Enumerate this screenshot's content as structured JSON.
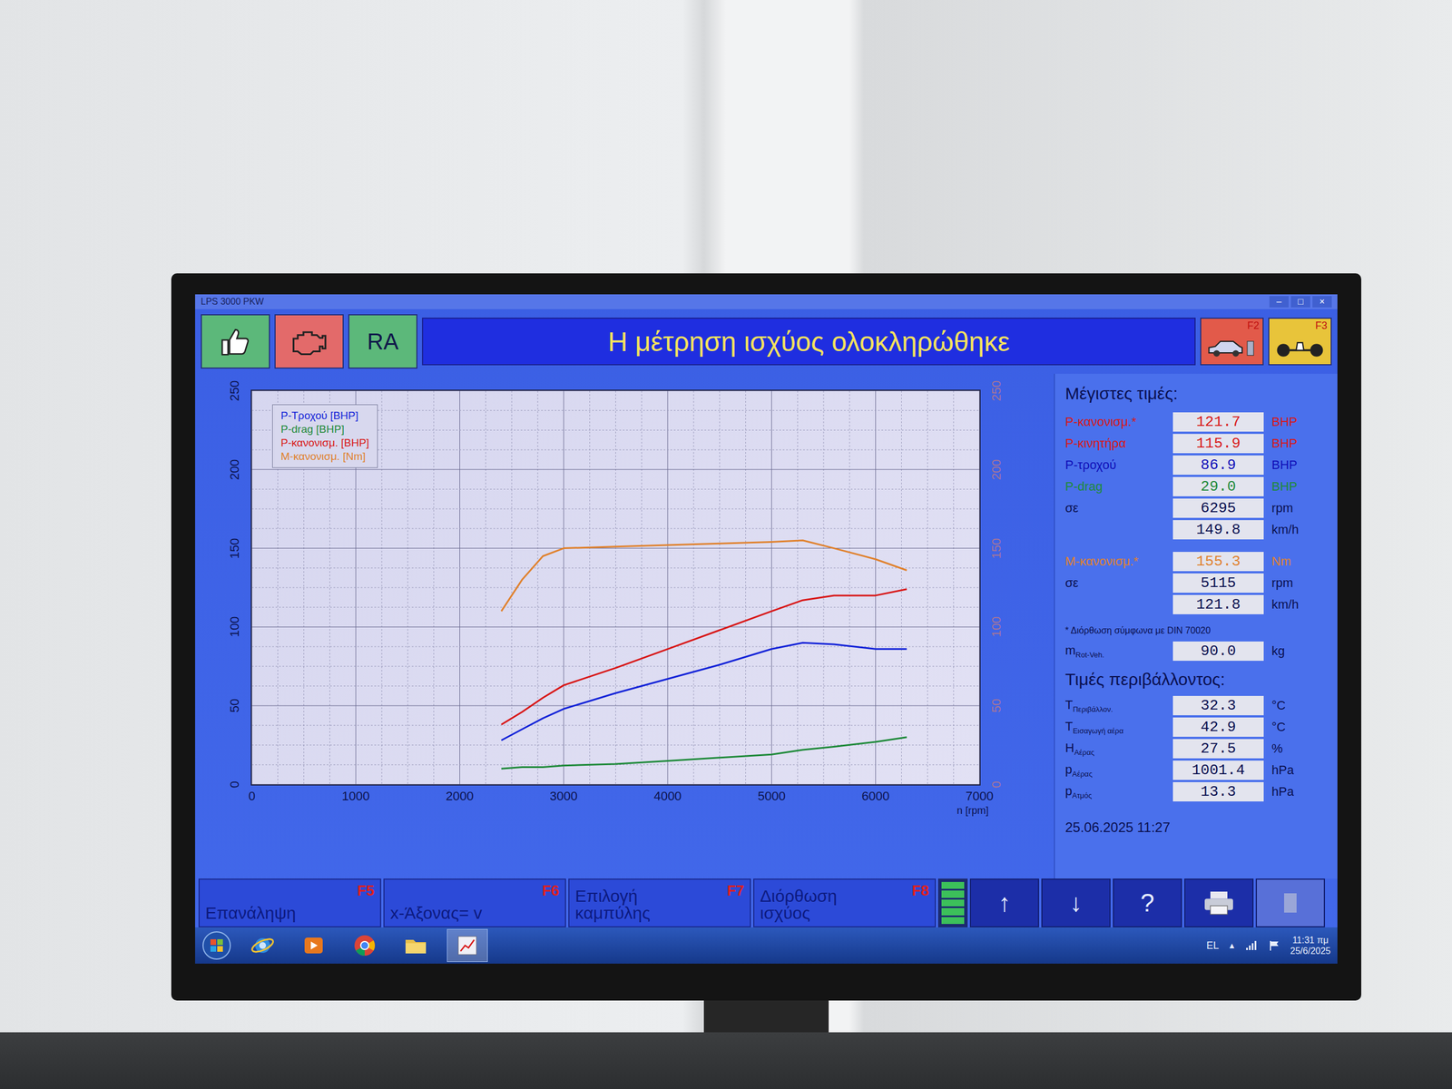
{
  "window": {
    "title": "LPS 3000 PKW",
    "controls": [
      "–",
      "□",
      "×"
    ]
  },
  "toolbar": {
    "buttons": [
      {
        "kind": "thumb",
        "color": "#5cb87a"
      },
      {
        "kind": "engine",
        "color": "#e36a6a"
      },
      {
        "kind": "text",
        "label": "RA",
        "color": "#5cb87a"
      }
    ],
    "message": "Η μέτρηση ισχύος ολοκληρώθηκε",
    "shortcuts": [
      {
        "kind": "car",
        "key": "F2",
        "color": "#e25a4a"
      },
      {
        "kind": "axle",
        "key": "F3",
        "color": "#e8c43a"
      }
    ]
  },
  "chart": {
    "yTicks": [
      "0",
      "50",
      "100",
      "150",
      "200",
      "250"
    ],
    "yTicksRight": [
      "0",
      "50",
      "100",
      "150",
      "200",
      "250"
    ],
    "xTicks": [
      "0",
      "1000",
      "2000",
      "3000",
      "4000",
      "5000",
      "6000",
      "7000"
    ],
    "xUnit": "n [rpm]",
    "rpm": [
      2400,
      2600,
      2800,
      3000,
      3500,
      4000,
      4500,
      5000,
      5300,
      5600,
      6000,
      6300
    ],
    "series": [
      {
        "label": "P-Τροχού [BHP]",
        "color": "#1424d8",
        "values": [
          28,
          35,
          42,
          48,
          58,
          67,
          76,
          86,
          90,
          89,
          86,
          86
        ]
      },
      {
        "label": "P-drag [BHP]",
        "color": "#1f8a3a",
        "values": [
          10,
          11,
          11,
          12,
          13,
          15,
          17,
          19,
          22,
          24,
          27,
          30
        ]
      },
      {
        "label": "P-κανονισμ. [BHP]",
        "color": "#d81818",
        "values": [
          38,
          46,
          55,
          63,
          74,
          86,
          98,
          110,
          117,
          120,
          120,
          124
        ]
      },
      {
        "label": "M-κανονισμ. [Nm]",
        "color": "#e0822e",
        "values": [
          110,
          130,
          145,
          150,
          151,
          152,
          153,
          154,
          155,
          150,
          143,
          136
        ]
      }
    ]
  },
  "maxValues": {
    "title": "Μέγιστες τιμές:",
    "groups": [
      [
        {
          "label": "P-κανονισμ.*",
          "value": "121.7",
          "unit": "BHP",
          "color": "#d81818"
        },
        {
          "label": "P-κινητήρα",
          "value": "115.9",
          "unit": "BHP",
          "color": "#d81818"
        },
        {
          "label": "P-τροχού",
          "value": "86.9",
          "unit": "BHP",
          "color": "#1010b8"
        },
        {
          "label": "P-drag",
          "value": "29.0",
          "unit": "BHP",
          "color": "#1f8a3a"
        },
        {
          "label": "σε",
          "value": "6295",
          "unit": "rpm",
          "color": "#0a1050"
        },
        {
          "label": "",
          "value": "149.8",
          "unit": "km/h",
          "color": "#0a1050"
        }
      ],
      [
        {
          "label": "M-κανονισμ.*",
          "value": "155.3",
          "unit": "Nm",
          "color": "#e0822e"
        },
        {
          "label": "σε",
          "value": "5115",
          "unit": "rpm",
          "color": "#0a1050"
        },
        {
          "label": "",
          "value": "121.8",
          "unit": "km/h",
          "color": "#0a1050"
        }
      ]
    ]
  },
  "note": "* Διόρθωση σύμφωνα με DIN 70020",
  "mass": {
    "symbol": "m",
    "sub": "Rot-Veh.",
    "value": "90.0",
    "unit": "kg"
  },
  "environment": {
    "title": "Τιμές περιβάλλοντος:",
    "rows": [
      {
        "symbol": "T",
        "sub": "Περιβάλλον.",
        "value": "32.3",
        "unit": "°C"
      },
      {
        "symbol": "T",
        "sub": "Εισαγωγή αέρα",
        "value": "42.9",
        "unit": "°C"
      },
      {
        "symbol": "H",
        "sub": "Αέρας",
        "value": "27.5",
        "unit": "%"
      },
      {
        "symbol": "p",
        "sub": "Αέρας",
        "value": "1001.4",
        "unit": "hPa"
      },
      {
        "symbol": "p",
        "sub": "Ατμός",
        "value": "13.3",
        "unit": "hPa"
      }
    ]
  },
  "timestamp": "25.06.2025 11:27",
  "functionKeys": [
    {
      "label": "Επανάληψη",
      "key": "F5"
    },
    {
      "label": "x-Άξονας= v",
      "key": "F6"
    },
    {
      "label": "Επιλογή καμπύλης",
      "key": "F7"
    },
    {
      "label": "Διόρθωση ισχύος",
      "key": "F8"
    }
  ],
  "indicator": {
    "level": 1
  },
  "navButtons": [
    {
      "label": "↑"
    },
    {
      "label": "↓"
    },
    {
      "label": "?"
    }
  ],
  "printButton": {
    "disabled": false
  },
  "extraButton": {
    "disabled": true
  },
  "taskbar": {
    "apps": [
      {
        "kind": "ie",
        "selected": false
      },
      {
        "kind": "media",
        "selected": false
      },
      {
        "kind": "chrome",
        "selected": false
      },
      {
        "kind": "folder",
        "selected": false
      },
      {
        "kind": "lps",
        "selected": true
      }
    ],
    "language": "EL",
    "trayArrow": "▲",
    "time": "11:31 πμ",
    "date": "25/6/2025"
  }
}
